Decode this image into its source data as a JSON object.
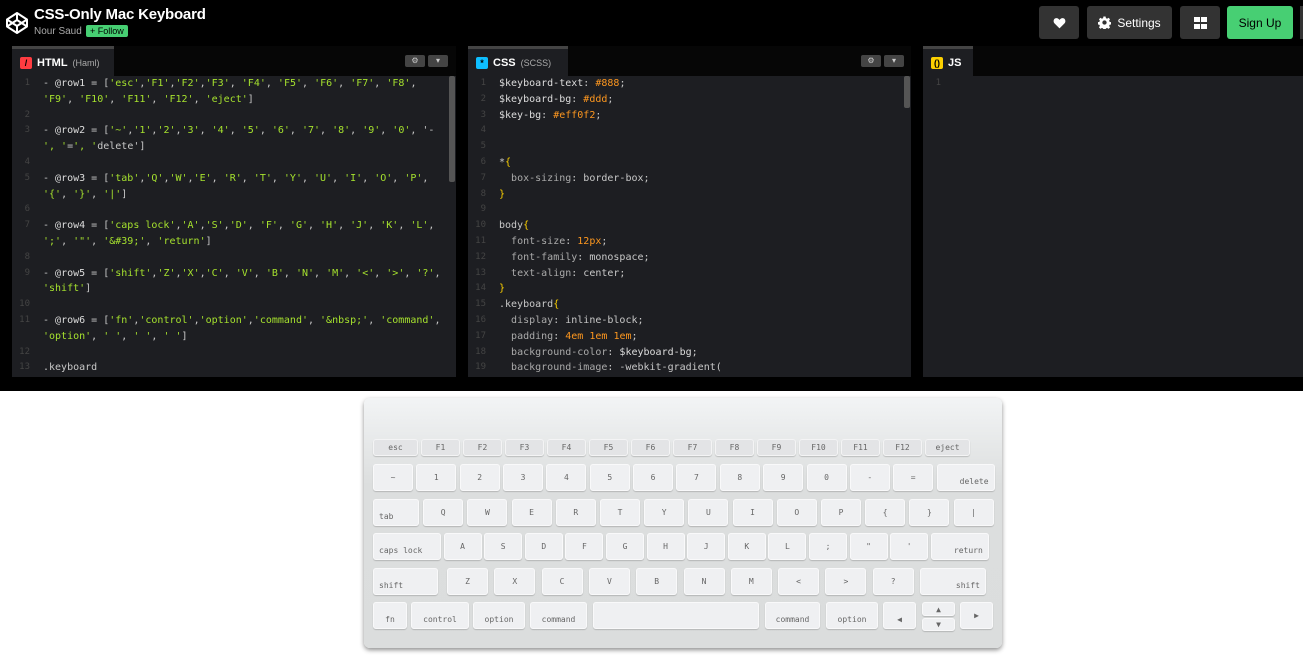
{
  "header": {
    "title": "CSS-Only Mac Keyboard",
    "author": "Nour Saud",
    "follow_label": "+ Follow",
    "settings_label": "Settings",
    "signup_label": "Sign Up",
    "icons": {
      "logo": "codepen-logo-icon",
      "heart": "heart-icon",
      "settings": "gear-icon",
      "layout": "layout-grid-icon"
    }
  },
  "panes": {
    "html": {
      "label": "HTML",
      "sub": "(Haml)",
      "badge": "/",
      "badge_color": "#ff3c41",
      "lines": [
        {
          "n": "1",
          "t": "- @row1 = ['esc','F1','F2','F3', 'F4', 'F5', 'F6', 'F7', 'F8',"
        },
        {
          "n": "",
          "t": "'F9', 'F10', 'F11', 'F12', 'eject']"
        },
        {
          "n": "2",
          "t": ""
        },
        {
          "n": "3",
          "t": "- @row2 = ['~','1','2','3', '4', '5', '6', '7', '8', '9', '0', '-"
        },
        {
          "n": "",
          "t": "', '=', 'delete']"
        },
        {
          "n": "4",
          "t": ""
        },
        {
          "n": "5",
          "t": "- @row3 = ['tab','Q','W','E', 'R', 'T', 'Y', 'U', 'I', 'O', 'P',"
        },
        {
          "n": "",
          "t": "'{', '}', '|']"
        },
        {
          "n": "6",
          "t": ""
        },
        {
          "n": "7",
          "t": "- @row4 = ['caps lock','A','S','D', 'F', 'G', 'H', 'J', 'K', 'L',"
        },
        {
          "n": "",
          "t": "';', '\"', '&#39;', 'return']"
        },
        {
          "n": "8",
          "t": ""
        },
        {
          "n": "9",
          "t": "- @row5 = ['shift','Z','X','C', 'V', 'B', 'N', 'M', '<', '>', '?',"
        },
        {
          "n": "",
          "t": "'shift']"
        },
        {
          "n": "10",
          "t": ""
        },
        {
          "n": "11",
          "t": "- @row6 = ['fn','control','option','command', '&nbsp;', 'command',"
        },
        {
          "n": "",
          "t": "'option', ' ', ' ', ' ']"
        },
        {
          "n": "12",
          "t": ""
        },
        {
          "n": "13",
          "t": ".keyboard"
        }
      ]
    },
    "css": {
      "label": "CSS",
      "sub": "(SCSS)",
      "badge": "*",
      "badge_color": "#0ebeff",
      "lines": [
        {
          "n": "1",
          "t": "$keyboard-text: #888;"
        },
        {
          "n": "2",
          "t": "$keyboard-bg: #ddd;"
        },
        {
          "n": "3",
          "t": "$key-bg: #eff0f2;"
        },
        {
          "n": "4",
          "t": ""
        },
        {
          "n": "5",
          "t": ""
        },
        {
          "n": "6",
          "t": "*{"
        },
        {
          "n": "7",
          "t": "  box-sizing: border-box;"
        },
        {
          "n": "8",
          "t": "}"
        },
        {
          "n": "9",
          "t": ""
        },
        {
          "n": "10",
          "t": "body{"
        },
        {
          "n": "11",
          "t": "  font-size: 12px;"
        },
        {
          "n": "12",
          "t": "  font-family: monospace;"
        },
        {
          "n": "13",
          "t": "  text-align: center;"
        },
        {
          "n": "14",
          "t": "}"
        },
        {
          "n": "15",
          "t": ".keyboard{"
        },
        {
          "n": "16",
          "t": "  display: inline-block;"
        },
        {
          "n": "17",
          "t": "  padding: 4em 1em 1em;"
        },
        {
          "n": "18",
          "t": "  background-color: $keyboard-bg;"
        },
        {
          "n": "19",
          "t": "  background-image: -webkit-gradient("
        }
      ]
    },
    "js": {
      "label": "JS",
      "sub": "",
      "badge": "()",
      "badge_color": "#fcd000",
      "lines": [
        {
          "n": "1",
          "t": ""
        }
      ]
    }
  },
  "keyboard": {
    "row1": [
      "esc",
      "F1",
      "F2",
      "F3",
      "F4",
      "F5",
      "F6",
      "F7",
      "F8",
      "F9",
      "F10",
      "F11",
      "F12",
      "eject"
    ],
    "row2": [
      "~",
      "1",
      "2",
      "3",
      "4",
      "5",
      "6",
      "7",
      "8",
      "9",
      "0",
      "-",
      "=",
      "delete"
    ],
    "row3": [
      "tab",
      "Q",
      "W",
      "E",
      "R",
      "T",
      "Y",
      "U",
      "I",
      "O",
      "P",
      "{",
      "}",
      "|"
    ],
    "row4": [
      "caps lock",
      "A",
      "S",
      "D",
      "F",
      "G",
      "H",
      "J",
      "K",
      "L",
      ";",
      "\"",
      "'",
      "return"
    ],
    "row5": [
      "shift",
      "Z",
      "X",
      "C",
      "V",
      "B",
      "N",
      "M",
      "<",
      ">",
      "?",
      "shift"
    ],
    "row6": [
      "fn",
      "control",
      "option",
      "command",
      " ",
      "command",
      "option",
      "◀",
      "▲",
      "▼",
      "▶"
    ]
  }
}
